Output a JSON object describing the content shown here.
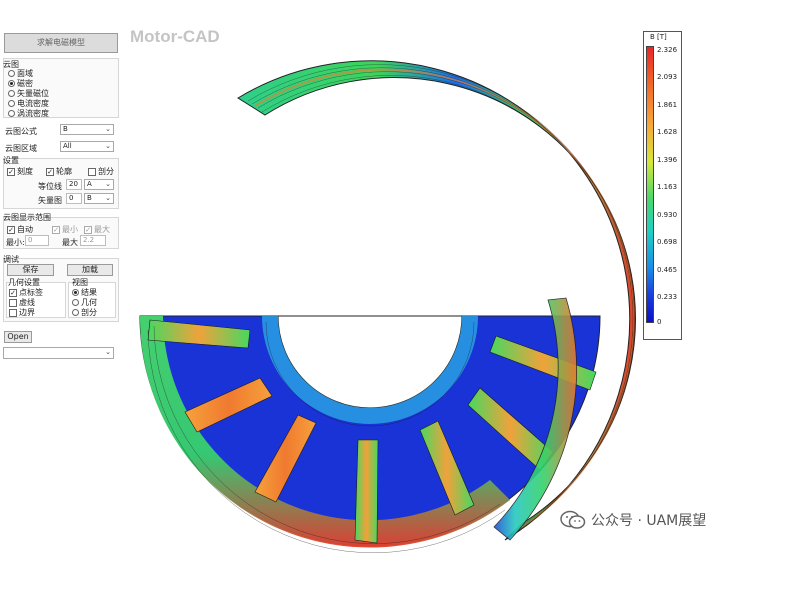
{
  "app": {
    "brand": "Motor-CAD",
    "title_button": "求解电磁模型"
  },
  "contour": {
    "group_title": "云图",
    "options": [
      "面域",
      "磁密",
      "矢量磁位",
      "电流密度",
      "涡流密度"
    ],
    "selected_index": 1,
    "formula_label": "云图公式",
    "formula_value": "B",
    "region_label": "云图区域",
    "region_value": "All"
  },
  "settings": {
    "group_title": "设置",
    "scale_label": "刻度",
    "scale_checked": true,
    "outline_label": "轮廓",
    "outline_checked": true,
    "mesh_label": "剖分",
    "mesh_checked": false,
    "contour_lines_label": "等位线",
    "contour_lines_value": "20",
    "contour_lines_unit": "A",
    "vector_label": "矢量图",
    "vector_value": "0",
    "vector_unit": "B"
  },
  "range": {
    "group_title": "云图显示范围",
    "auto_label": "自动",
    "auto_checked": true,
    "min_check_label": "最小",
    "max_check_label": "最大",
    "min_label": "最小",
    "min_value": "0",
    "max_label": "最大",
    "max_value": "2.2"
  },
  "debug": {
    "group_title": "调试",
    "save_label": "保存",
    "load_label": "加载",
    "geometry_title": "几何设置",
    "geometry_items": [
      {
        "label": "点标签",
        "checked": true
      },
      {
        "label": "虚线",
        "checked": false
      },
      {
        "label": "边界",
        "checked": false
      }
    ],
    "view_title": "视图",
    "view_options": [
      "结果",
      "几何",
      "剖分"
    ],
    "view_selected_index": 0
  },
  "open_label": "Open",
  "colorbar": {
    "title": "B [T]",
    "ticks": [
      "2.326",
      "2.093",
      "1.861",
      "1.628",
      "1.396",
      "1.163",
      "0.930",
      "0.698",
      "0.465",
      "0.233",
      "0"
    ],
    "colors": [
      "#e8262a",
      "#f7a63a",
      "#4cd86a",
      "#1b8fe8",
      "#0a10c8"
    ]
  },
  "watermark": "公众号 · UAM展望"
}
